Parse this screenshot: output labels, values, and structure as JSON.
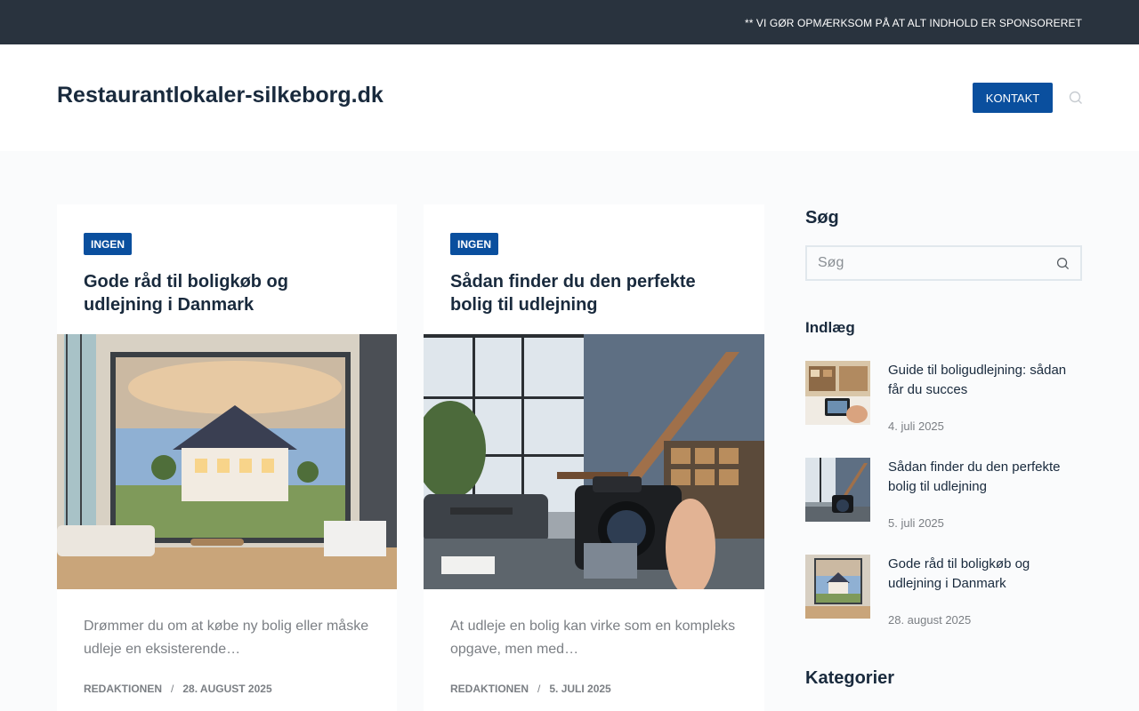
{
  "topbar": {
    "notice": "** VI GØR OPMÆRKSOM PÅ AT ALT INDHOLD ER SPONSORERET"
  },
  "header": {
    "site_title": "Restaurantlokaler-silkeborg.dk",
    "contact_label": "KONTAKT"
  },
  "posts": [
    {
      "category": "INGEN",
      "title": "Gode råd til boligkøb og udlejning i Danmark",
      "excerpt": "Drømmer du om at købe ny bolig eller måske udleje en eksisterende…",
      "author": "REDAKTIONEN",
      "separator": "/",
      "date": "28. AUGUST 2025"
    },
    {
      "category": "INGEN",
      "title": "Sådan finder du den perfekte bolig til udlejning",
      "excerpt": "At udleje en bolig kan virke som en kompleks opgave, men med…",
      "author": "REDAKTIONEN",
      "separator": "/",
      "date": "5. JULI 2025"
    }
  ],
  "sidebar": {
    "search_heading": "Søg",
    "search_placeholder": "Søg",
    "posts_heading": "Indlæg",
    "recent_posts": [
      {
        "title": "Guide til boligudlejning: sådan får du succes",
        "date": "4. juli 2025"
      },
      {
        "title": "Sådan finder du den perfekte bolig til udlejning",
        "date": "5. juli 2025"
      },
      {
        "title": "Gode råd til boligkøb og udlejning i Danmark",
        "date": "28. august 2025"
      }
    ],
    "categories_heading": "Kategorier"
  },
  "colors": {
    "accent": "#0a4f9e",
    "topbar": "#29333e",
    "text": "#192a3d",
    "muted": "#7b7f84"
  }
}
